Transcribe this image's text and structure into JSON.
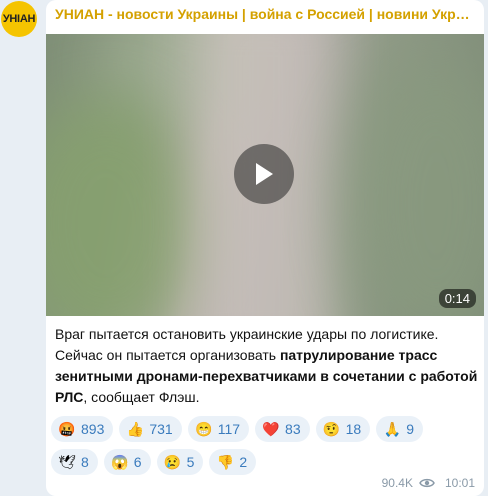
{
  "channel": {
    "avatar_text": "УНІАН",
    "title": "УНИАН - новости Украины | война с Россией | новини України"
  },
  "video": {
    "duration": "0:14"
  },
  "message": {
    "part1": "Враг пытается остановить украинские удары по логистике. Сейчас он пытается организовать ",
    "bold": "патрулирование трасс зенитными дронами-перехватчиками в сочетании с работой РЛС",
    "part2": ", сообщает Флэш."
  },
  "reactions": [
    [
      {
        "emoji": "🤬",
        "count": "893"
      },
      {
        "emoji": "👍",
        "count": "731"
      },
      {
        "emoji": "😁",
        "count": "117"
      },
      {
        "emoji": "❤️",
        "count": "83"
      },
      {
        "emoji": "🤨",
        "count": "18"
      },
      {
        "emoji": "🙏",
        "count": "9"
      }
    ],
    [
      {
        "emoji": "🕊",
        "count": "8"
      },
      {
        "emoji": "😱",
        "count": "6"
      },
      {
        "emoji": "😢",
        "count": "5"
      },
      {
        "emoji": "👎",
        "count": "2"
      }
    ]
  ],
  "footer": {
    "views": "90.4K",
    "time": "10:01"
  },
  "colors": {
    "title": "#d4a100",
    "reaction_count": "#3a7bbd",
    "avatar_bg": "#f5c400"
  }
}
